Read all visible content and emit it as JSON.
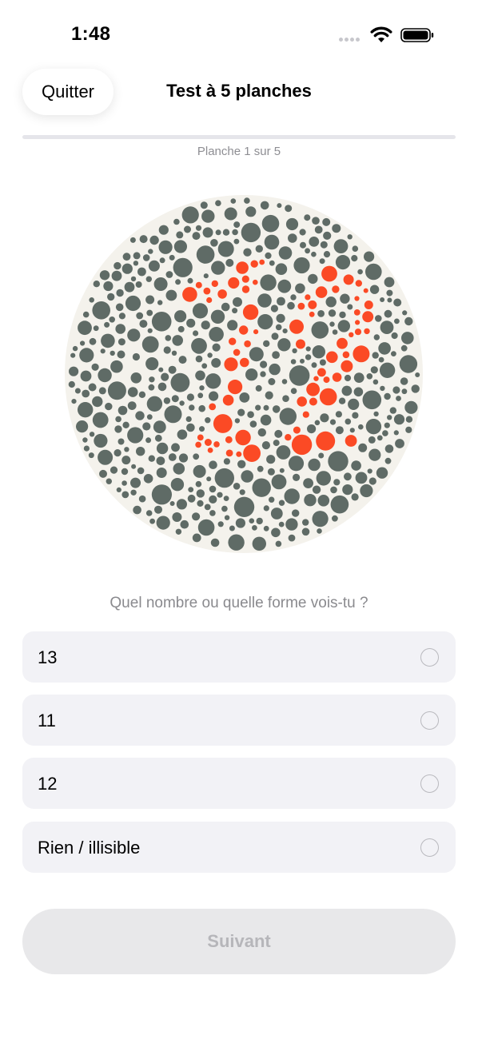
{
  "status_bar": {
    "time": "1:48"
  },
  "header": {
    "quit_label": "Quitter",
    "title": "Test à 5 planches"
  },
  "progress": {
    "label": "Planche 1 sur 5",
    "fraction": 0
  },
  "plate": {
    "hidden_number": "12",
    "background_color": "#5f6b66",
    "figure_color": "#fb4a25"
  },
  "question": "Quel nombre ou quelle forme vois-tu ?",
  "options": [
    {
      "label": "13"
    },
    {
      "label": "11"
    },
    {
      "label": "12"
    },
    {
      "label": "Rien / illisible"
    }
  ],
  "next_label": "Suivant"
}
